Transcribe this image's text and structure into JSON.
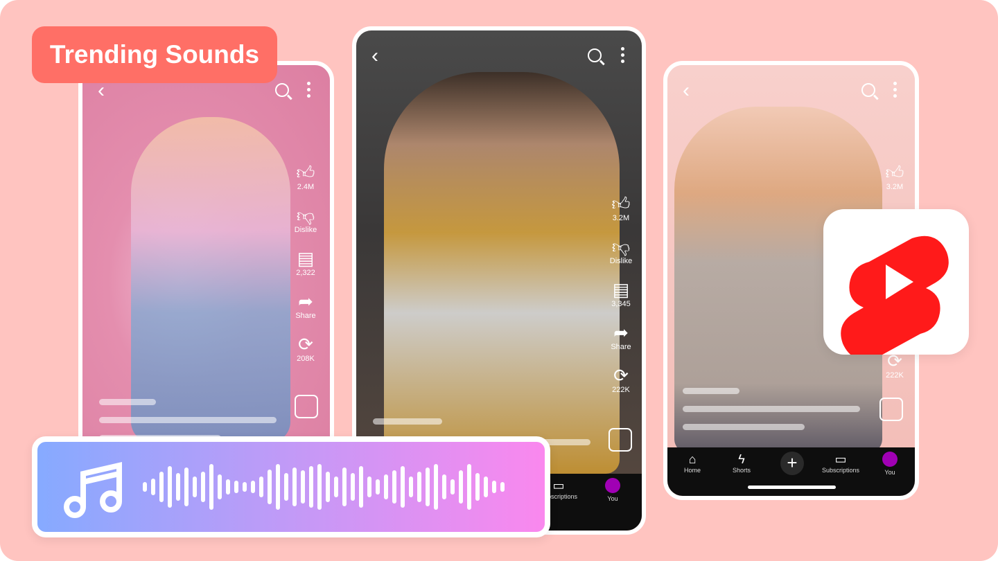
{
  "title_badge": "Trending Sounds",
  "colors": {
    "background": "#ffc4c0",
    "badge": "#ff6f66",
    "shorts_red": "#ff1a1a",
    "wave_start": "#86aaff",
    "wave_end": "#fa88ee",
    "nav": "#0e0e0e"
  },
  "phones": [
    {
      "actions": [
        {
          "icon": "thumbs-up-icon",
          "label": "2.4M"
        },
        {
          "icon": "thumbs-down-icon",
          "label": "Dislike"
        },
        {
          "icon": "comment-icon",
          "label": "2,322"
        },
        {
          "icon": "share-icon",
          "label": "Share"
        },
        {
          "icon": "remix-icon",
          "label": "208K"
        }
      ]
    },
    {
      "actions": [
        {
          "icon": "thumbs-up-icon",
          "label": "3.2M"
        },
        {
          "icon": "thumbs-down-icon",
          "label": "Dislike"
        },
        {
          "icon": "comment-icon",
          "label": "3,345"
        },
        {
          "icon": "share-icon",
          "label": "Share"
        },
        {
          "icon": "remix-icon",
          "label": "222K"
        }
      ],
      "nav": [
        {
          "label": "Subscriptions"
        },
        {
          "label": "You"
        }
      ]
    },
    {
      "actions": [
        {
          "icon": "thumbs-up-icon",
          "label": "3.2M"
        },
        {
          "icon": "remix-icon",
          "label": "222K"
        }
      ],
      "nav": [
        {
          "label": "Home"
        },
        {
          "label": "Shorts"
        },
        {
          "label": "Subscriptions"
        },
        {
          "label": "You"
        }
      ]
    }
  ],
  "icons": {
    "music": "music-note-icon",
    "logo": "youtube-shorts-logo"
  }
}
